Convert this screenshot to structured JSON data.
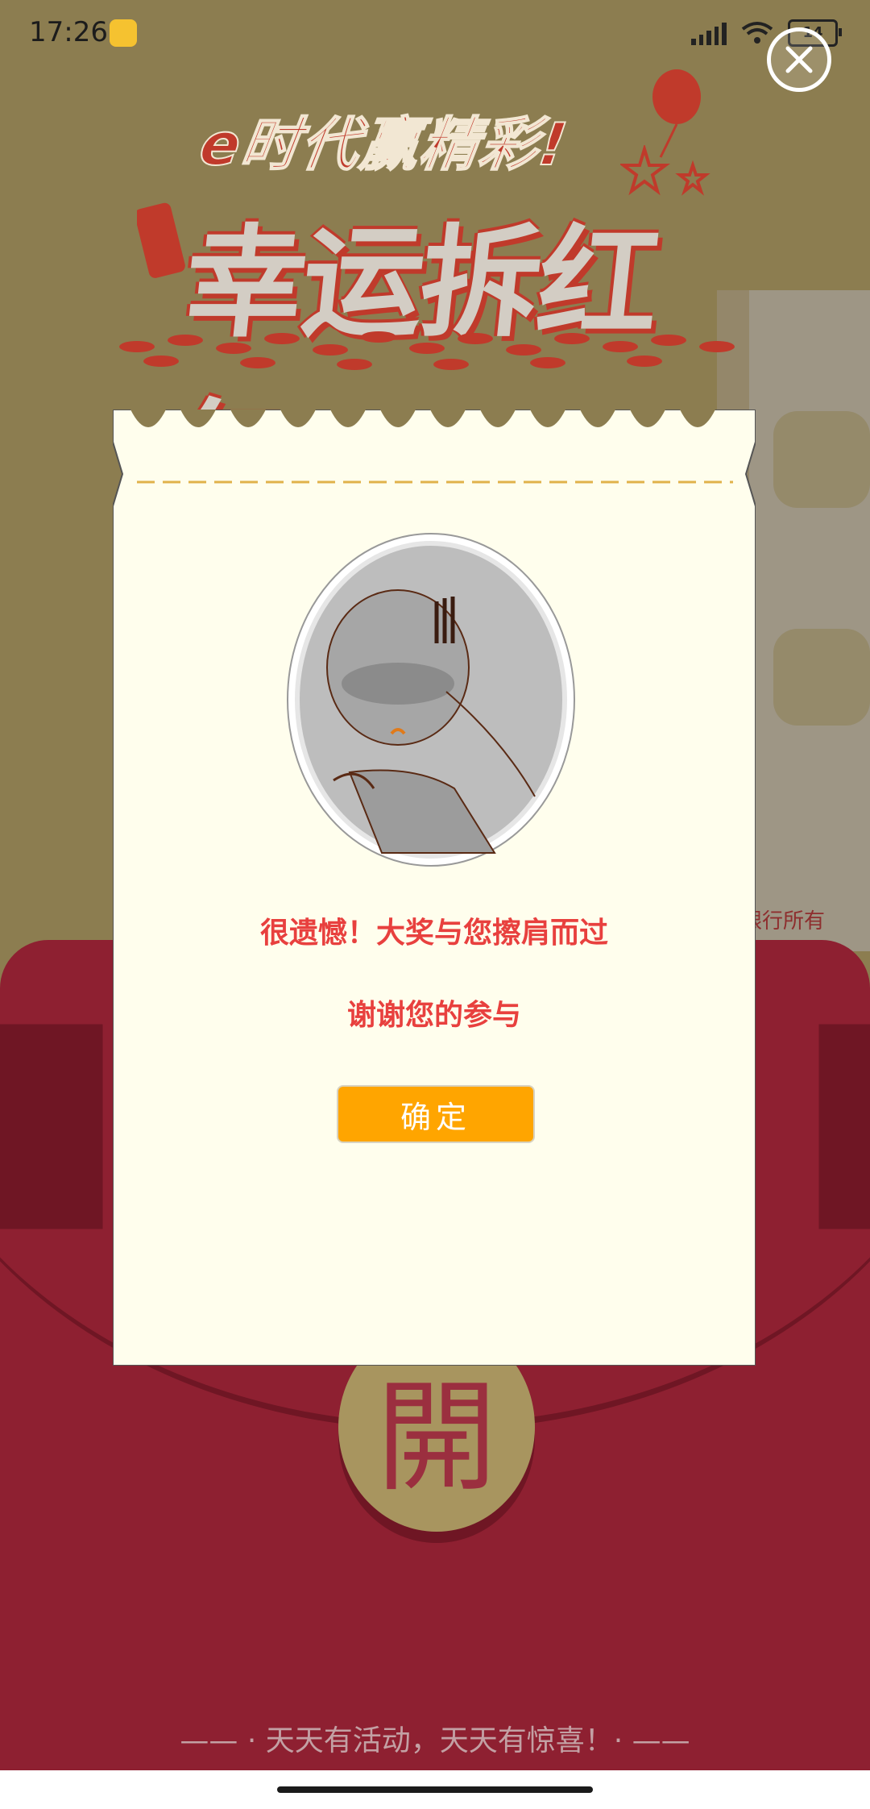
{
  "status_bar": {
    "time": "17:26",
    "battery_level": "14"
  },
  "banner": {
    "tagline": "e时代赢精彩!",
    "title": "幸运拆红包"
  },
  "envelope": {
    "open_char": "開",
    "copyright_fragment": "银行所有",
    "color": "#8e2031"
  },
  "dialog": {
    "message_line1": "很遗憾！大奖与您擦肩而过",
    "message_line2": "谢谢您的参与",
    "confirm_label": "确定",
    "accent_color": "#ffa500",
    "text_color": "#e8403e"
  },
  "footer": {
    "slogan": "—— · 天天有活动，天天有惊喜！· ——"
  },
  "icons": {
    "close": "close-icon",
    "signal": "signal-icon",
    "wifi": "wifi-icon",
    "battery": "battery-icon"
  }
}
